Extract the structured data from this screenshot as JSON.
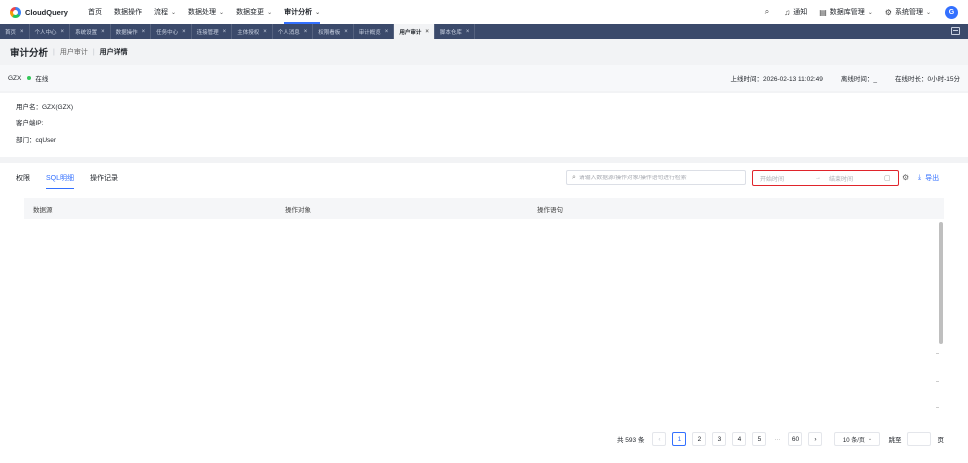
{
  "app": {
    "name": "CloudQuery"
  },
  "topnav": {
    "items": [
      {
        "label": "首页",
        "has_menu": false,
        "active": false
      },
      {
        "label": "数据操作",
        "has_menu": false,
        "active": false
      },
      {
        "label": "流程",
        "has_menu": true,
        "active": false
      },
      {
        "label": "数据处理",
        "has_menu": true,
        "active": false
      },
      {
        "label": "数据变更",
        "has_menu": true,
        "active": false
      },
      {
        "label": "审计分析",
        "has_menu": true,
        "active": true
      }
    ],
    "right": {
      "notify": "通知",
      "db_manage": "数据库管理",
      "sys_manage": "系统管理",
      "avatar": "G"
    }
  },
  "tabs": [
    {
      "label": "首页",
      "active": false
    },
    {
      "label": "个人中心",
      "active": false
    },
    {
      "label": "系统设置",
      "active": false
    },
    {
      "label": "数据操作",
      "active": false
    },
    {
      "label": "任务中心",
      "active": false
    },
    {
      "label": "连接管理",
      "active": false
    },
    {
      "label": "主体授权",
      "active": false
    },
    {
      "label": "个人消息",
      "active": false
    },
    {
      "label": "权限看板",
      "active": false
    },
    {
      "label": "审计概览",
      "active": false
    },
    {
      "label": "用户审计",
      "active": true
    },
    {
      "label": "脚本仓库",
      "active": false
    }
  ],
  "breadcrumb": {
    "root": "审计分析",
    "parent": "用户审计",
    "current": "用户详情"
  },
  "status": {
    "user": "GZX",
    "state": "在线",
    "online_time": "上线时间：2026-02-13 11:02:49",
    "offline_time": "离线时间：_",
    "duration": "在线时长：0小时-15分"
  },
  "info": {
    "username": "用户名：GZX(GZX)",
    "client_ip": "客户端IP:",
    "dept": "部门：cqUser"
  },
  "subtabs": [
    {
      "label": "权限",
      "active": false
    },
    {
      "label": "SQL明细",
      "active": true
    },
    {
      "label": "操作记录",
      "active": false
    }
  ],
  "search": {
    "placeholder": "请输入数据源/操作对象/操作语句进行检索"
  },
  "daterange": {
    "start": "开始时间",
    "end": "结束时间"
  },
  "export_label": "导出",
  "table": {
    "columns": [
      "数据源",
      "操作对象",
      "操作语句"
    ]
  },
  "pager": {
    "total": "共 593 条",
    "pages": [
      "1",
      "2",
      "3",
      "4",
      "5",
      "···",
      "60"
    ],
    "current": "1",
    "page_size": "10 条/页",
    "goto": "跳至",
    "goto_suffix": "页"
  },
  "colors": {
    "accent": "#3370ff",
    "tabbar": "#3b4a6b",
    "highlight": "#e0242b",
    "online": "#34c759"
  }
}
